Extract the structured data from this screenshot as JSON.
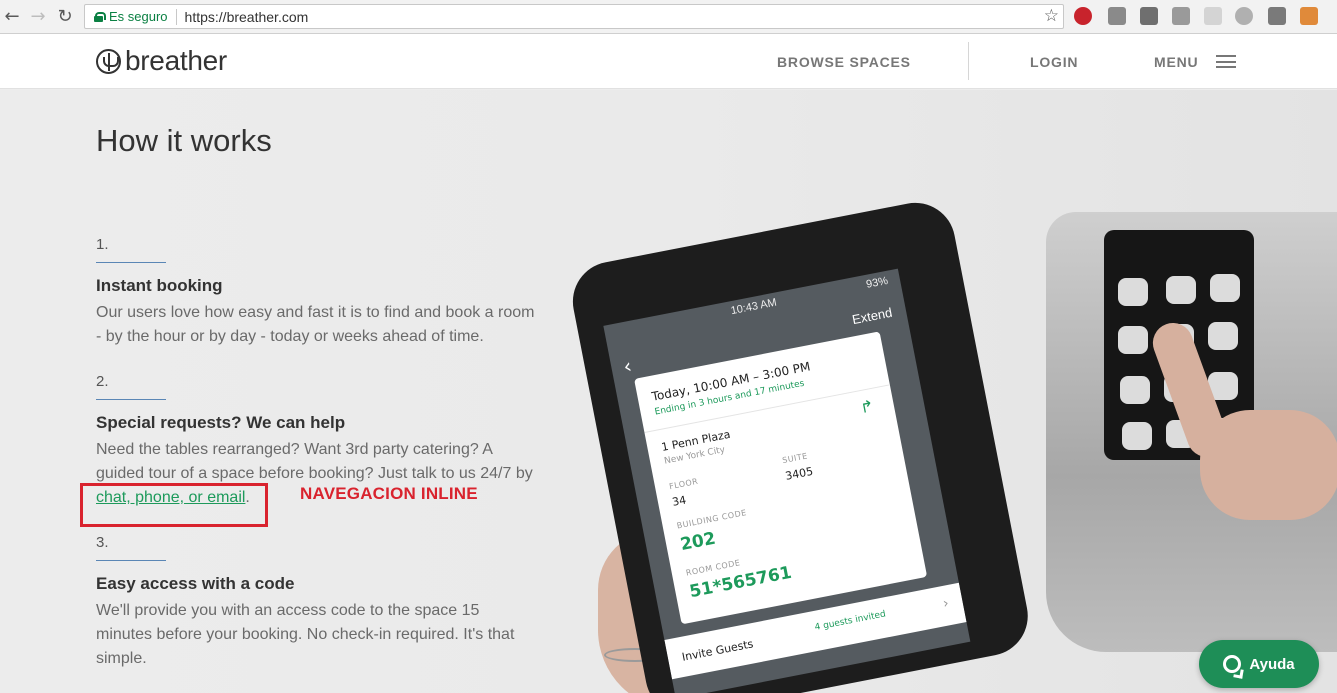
{
  "browser": {
    "secure_label": "Es seguro",
    "url": "https://breather.com"
  },
  "header": {
    "logo_text": "breather",
    "browse_label": "BROWSE SPACES",
    "login_label": "LOGIN",
    "menu_label": "MENU"
  },
  "main": {
    "title": "How it works",
    "steps": [
      {
        "number": "1.",
        "title": "Instant booking",
        "body": "Our users love how easy and fast it is to find and book a room - by the hour or by day - today or weeks ahead of time."
      },
      {
        "number": "2.",
        "title": "Special requests? We can help",
        "body": "Need the tables rearranged? Want 3rd party catering? A guided tour of a space before booking? Just talk to us 24/7 by",
        "link_text": "chat, phone, or email",
        "after_link": "."
      },
      {
        "number": "3.",
        "title": "Easy access with a code",
        "body": "We'll provide you with an access code to the space 15 minutes before your booking. No check-in required. It's that simple."
      }
    ],
    "annotation_label": "NAVEGACION INLINE"
  },
  "phone_screen": {
    "time": "10:43 AM",
    "battery": "93%",
    "extend_label": "Extend",
    "booking_time": "Today, 10:00 AM – 3:00 PM",
    "ending": "Ending in 3 hours and 17 minutes",
    "place": "1 Penn Plaza",
    "city": "New York City",
    "floor_label": "FLOOR",
    "floor_value": "34",
    "suite_label": "SUITE",
    "suite_value": "3405",
    "building_code_label": "BUILDING CODE",
    "building_code": "202",
    "room_code_label": "ROOM CODE",
    "room_code": "51*565761",
    "invite_label": "Invite Guests",
    "guests_invited": "4 guests invited"
  },
  "help": {
    "label": "Ayuda"
  },
  "colors": {
    "accent_green": "#1d9a5b",
    "annotation_red": "#d9232e",
    "help_green": "#1e8e57"
  }
}
